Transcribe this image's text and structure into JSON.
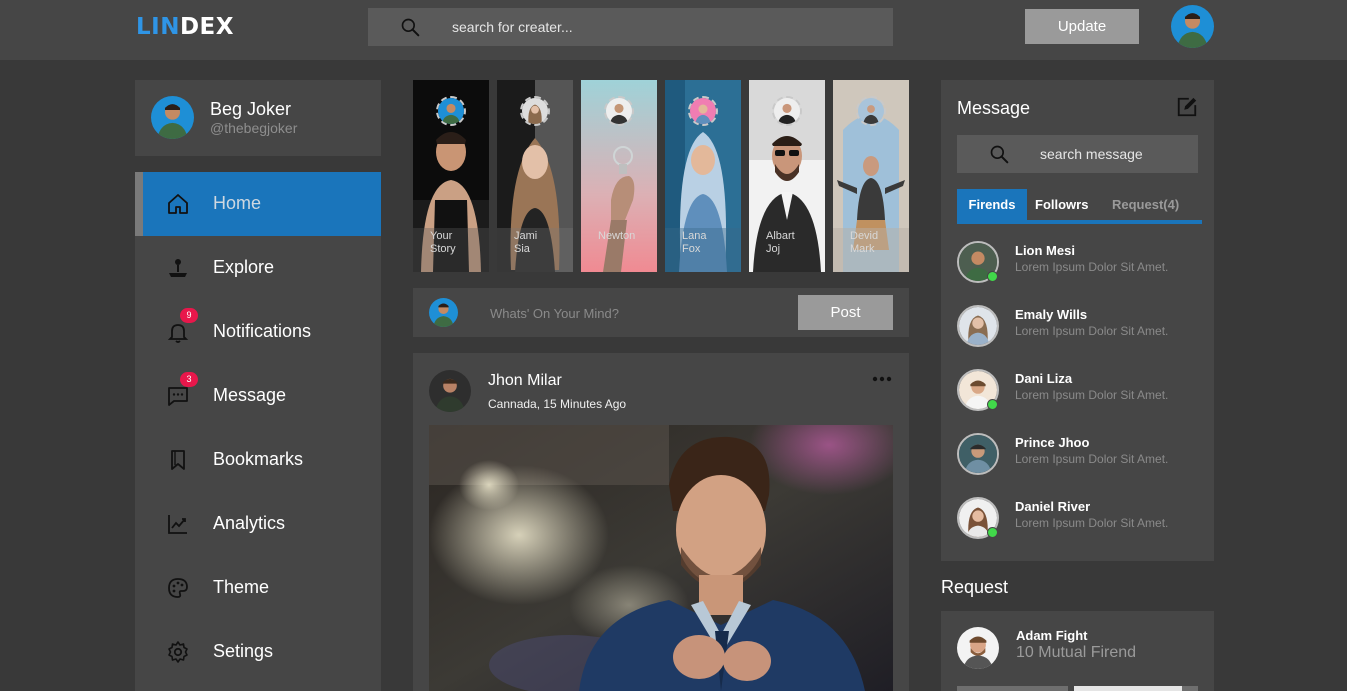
{
  "app": {
    "logo_part1": "LIN",
    "logo_part2": "DEX",
    "search_placeholder": "search for creater...",
    "update_label": "Update"
  },
  "profile": {
    "name": "Beg Joker",
    "handle": "@thebegjoker"
  },
  "sidebar": {
    "items": [
      {
        "label": "Home",
        "icon": "home-icon",
        "active": true
      },
      {
        "label": "Explore",
        "icon": "joystick-icon"
      },
      {
        "label": "Notifications",
        "icon": "bell-icon",
        "badge": "9"
      },
      {
        "label": "Message",
        "icon": "chat-icon",
        "badge": "3"
      },
      {
        "label": "Bookmarks",
        "icon": "bookmark-icon"
      },
      {
        "label": "Analytics",
        "icon": "chart-line-icon"
      },
      {
        "label": "Theme",
        "icon": "palette-icon"
      },
      {
        "label": "Setings",
        "icon": "gear-icon"
      }
    ]
  },
  "stories": [
    {
      "name_line1": "Your",
      "name_line2": "Story"
    },
    {
      "name_line1": "Jami",
      "name_line2": "Sia"
    },
    {
      "name_line1": "Newton",
      "name_line2": ""
    },
    {
      "name_line1": "Lana",
      "name_line2": "Fox"
    },
    {
      "name_line1": "Albart",
      "name_line2": "Joj"
    },
    {
      "name_line1": "Devid",
      "name_line2": "Mark"
    }
  ],
  "composer": {
    "placeholder": "Whats' On Your Mind?",
    "post_label": "Post"
  },
  "post": {
    "author": "Jhon Milar",
    "meta": "Cannada, 15 Minutes Ago"
  },
  "messages": {
    "title": "Message",
    "search_placeholder": "search message",
    "tabs": [
      "Firends",
      "Followrs",
      "Request(4)"
    ],
    "friends": [
      {
        "name": "Lion Mesi",
        "text": "Lorem Ipsum Dolor Sit Amet.",
        "online": true
      },
      {
        "name": "Emaly Wills",
        "text": "Lorem Ipsum Dolor Sit Amet.",
        "online": false
      },
      {
        "name": "Dani Liza",
        "text": "Lorem Ipsum Dolor Sit Amet.",
        "online": true
      },
      {
        "name": "Prince Jhoo",
        "text": "Lorem Ipsum Dolor Sit Amet.",
        "online": false
      },
      {
        "name": "Daniel River",
        "text": "Lorem Ipsum Dolor Sit Amet.",
        "online": true
      }
    ]
  },
  "requests": {
    "title": "Request",
    "items": [
      {
        "name": "Adam Fight",
        "mutual": "10 Mutual Firend"
      }
    ]
  },
  "colors": {
    "accent": "#1a75bb",
    "logo_blue": "#2f95e6",
    "background": "#393939",
    "panel": "#464646",
    "badge": "#e8174b",
    "online": "#41d94a"
  }
}
